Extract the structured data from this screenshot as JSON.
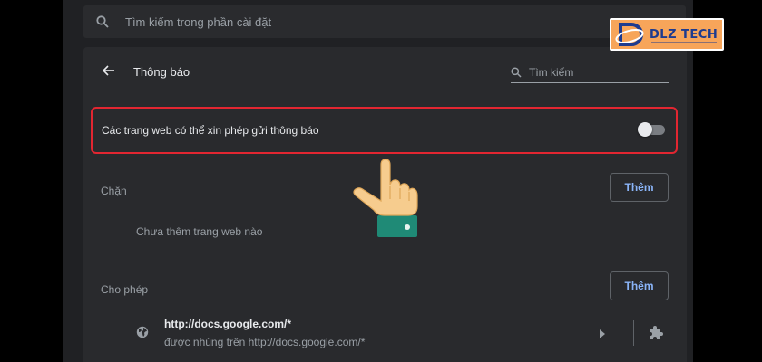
{
  "search": {
    "placeholder": "Tìm kiếm trong phần cài đặt",
    "icon": "search-icon"
  },
  "header": {
    "title": "Thông báo",
    "search_label": "Tìm kiếm"
  },
  "toggle_setting": {
    "label": "Các trang web có thể xin phép gửi thông báo",
    "enabled": false
  },
  "blocked": {
    "title": "Chặn",
    "add_label": "Thêm",
    "empty_message": "Chưa thêm trang web nào"
  },
  "allowed": {
    "title": "Cho phép",
    "add_label": "Thêm",
    "sites": [
      {
        "url": "http://docs.google.com/*",
        "detail": "được nhúng trên http://docs.google.com/*"
      }
    ]
  },
  "watermark": {
    "brand": "DLZ TECH"
  },
  "colors": {
    "highlight": "#e22631",
    "accent": "#8ab4f8",
    "logo_bg": "#f7a55a",
    "logo_text": "#1d3b8f"
  }
}
